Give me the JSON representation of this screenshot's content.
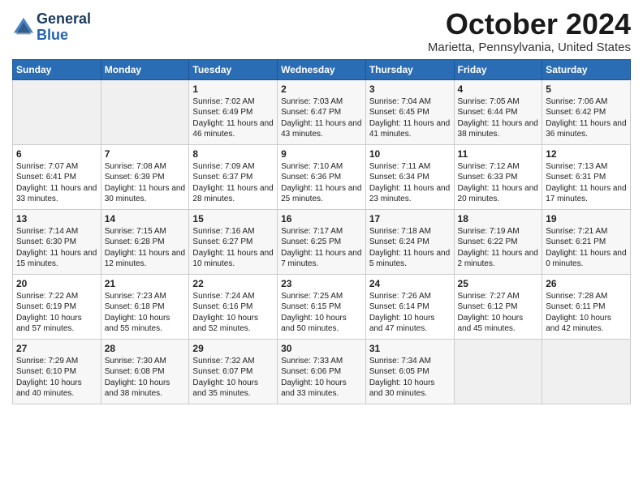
{
  "header": {
    "logo_line1": "General",
    "logo_line2": "Blue",
    "month": "October 2024",
    "location": "Marietta, Pennsylvania, United States"
  },
  "weekdays": [
    "Sunday",
    "Monday",
    "Tuesday",
    "Wednesday",
    "Thursday",
    "Friday",
    "Saturday"
  ],
  "weeks": [
    [
      {
        "day": "",
        "sunrise": "",
        "sunset": "",
        "daylight": ""
      },
      {
        "day": "",
        "sunrise": "",
        "sunset": "",
        "daylight": ""
      },
      {
        "day": "1",
        "sunrise": "Sunrise: 7:02 AM",
        "sunset": "Sunset: 6:49 PM",
        "daylight": "Daylight: 11 hours and 46 minutes."
      },
      {
        "day": "2",
        "sunrise": "Sunrise: 7:03 AM",
        "sunset": "Sunset: 6:47 PM",
        "daylight": "Daylight: 11 hours and 43 minutes."
      },
      {
        "day": "3",
        "sunrise": "Sunrise: 7:04 AM",
        "sunset": "Sunset: 6:45 PM",
        "daylight": "Daylight: 11 hours and 41 minutes."
      },
      {
        "day": "4",
        "sunrise": "Sunrise: 7:05 AM",
        "sunset": "Sunset: 6:44 PM",
        "daylight": "Daylight: 11 hours and 38 minutes."
      },
      {
        "day": "5",
        "sunrise": "Sunrise: 7:06 AM",
        "sunset": "Sunset: 6:42 PM",
        "daylight": "Daylight: 11 hours and 36 minutes."
      }
    ],
    [
      {
        "day": "6",
        "sunrise": "Sunrise: 7:07 AM",
        "sunset": "Sunset: 6:41 PM",
        "daylight": "Daylight: 11 hours and 33 minutes."
      },
      {
        "day": "7",
        "sunrise": "Sunrise: 7:08 AM",
        "sunset": "Sunset: 6:39 PM",
        "daylight": "Daylight: 11 hours and 30 minutes."
      },
      {
        "day": "8",
        "sunrise": "Sunrise: 7:09 AM",
        "sunset": "Sunset: 6:37 PM",
        "daylight": "Daylight: 11 hours and 28 minutes."
      },
      {
        "day": "9",
        "sunrise": "Sunrise: 7:10 AM",
        "sunset": "Sunset: 6:36 PM",
        "daylight": "Daylight: 11 hours and 25 minutes."
      },
      {
        "day": "10",
        "sunrise": "Sunrise: 7:11 AM",
        "sunset": "Sunset: 6:34 PM",
        "daylight": "Daylight: 11 hours and 23 minutes."
      },
      {
        "day": "11",
        "sunrise": "Sunrise: 7:12 AM",
        "sunset": "Sunset: 6:33 PM",
        "daylight": "Daylight: 11 hours and 20 minutes."
      },
      {
        "day": "12",
        "sunrise": "Sunrise: 7:13 AM",
        "sunset": "Sunset: 6:31 PM",
        "daylight": "Daylight: 11 hours and 17 minutes."
      }
    ],
    [
      {
        "day": "13",
        "sunrise": "Sunrise: 7:14 AM",
        "sunset": "Sunset: 6:30 PM",
        "daylight": "Daylight: 11 hours and 15 minutes."
      },
      {
        "day": "14",
        "sunrise": "Sunrise: 7:15 AM",
        "sunset": "Sunset: 6:28 PM",
        "daylight": "Daylight: 11 hours and 12 minutes."
      },
      {
        "day": "15",
        "sunrise": "Sunrise: 7:16 AM",
        "sunset": "Sunset: 6:27 PM",
        "daylight": "Daylight: 11 hours and 10 minutes."
      },
      {
        "day": "16",
        "sunrise": "Sunrise: 7:17 AM",
        "sunset": "Sunset: 6:25 PM",
        "daylight": "Daylight: 11 hours and 7 minutes."
      },
      {
        "day": "17",
        "sunrise": "Sunrise: 7:18 AM",
        "sunset": "Sunset: 6:24 PM",
        "daylight": "Daylight: 11 hours and 5 minutes."
      },
      {
        "day": "18",
        "sunrise": "Sunrise: 7:19 AM",
        "sunset": "Sunset: 6:22 PM",
        "daylight": "Daylight: 11 hours and 2 minutes."
      },
      {
        "day": "19",
        "sunrise": "Sunrise: 7:21 AM",
        "sunset": "Sunset: 6:21 PM",
        "daylight": "Daylight: 11 hours and 0 minutes."
      }
    ],
    [
      {
        "day": "20",
        "sunrise": "Sunrise: 7:22 AM",
        "sunset": "Sunset: 6:19 PM",
        "daylight": "Daylight: 10 hours and 57 minutes."
      },
      {
        "day": "21",
        "sunrise": "Sunrise: 7:23 AM",
        "sunset": "Sunset: 6:18 PM",
        "daylight": "Daylight: 10 hours and 55 minutes."
      },
      {
        "day": "22",
        "sunrise": "Sunrise: 7:24 AM",
        "sunset": "Sunset: 6:16 PM",
        "daylight": "Daylight: 10 hours and 52 minutes."
      },
      {
        "day": "23",
        "sunrise": "Sunrise: 7:25 AM",
        "sunset": "Sunset: 6:15 PM",
        "daylight": "Daylight: 10 hours and 50 minutes."
      },
      {
        "day": "24",
        "sunrise": "Sunrise: 7:26 AM",
        "sunset": "Sunset: 6:14 PM",
        "daylight": "Daylight: 10 hours and 47 minutes."
      },
      {
        "day": "25",
        "sunrise": "Sunrise: 7:27 AM",
        "sunset": "Sunset: 6:12 PM",
        "daylight": "Daylight: 10 hours and 45 minutes."
      },
      {
        "day": "26",
        "sunrise": "Sunrise: 7:28 AM",
        "sunset": "Sunset: 6:11 PM",
        "daylight": "Daylight: 10 hours and 42 minutes."
      }
    ],
    [
      {
        "day": "27",
        "sunrise": "Sunrise: 7:29 AM",
        "sunset": "Sunset: 6:10 PM",
        "daylight": "Daylight: 10 hours and 40 minutes."
      },
      {
        "day": "28",
        "sunrise": "Sunrise: 7:30 AM",
        "sunset": "Sunset: 6:08 PM",
        "daylight": "Daylight: 10 hours and 38 minutes."
      },
      {
        "day": "29",
        "sunrise": "Sunrise: 7:32 AM",
        "sunset": "Sunset: 6:07 PM",
        "daylight": "Daylight: 10 hours and 35 minutes."
      },
      {
        "day": "30",
        "sunrise": "Sunrise: 7:33 AM",
        "sunset": "Sunset: 6:06 PM",
        "daylight": "Daylight: 10 hours and 33 minutes."
      },
      {
        "day": "31",
        "sunrise": "Sunrise: 7:34 AM",
        "sunset": "Sunset: 6:05 PM",
        "daylight": "Daylight: 10 hours and 30 minutes."
      },
      {
        "day": "",
        "sunrise": "",
        "sunset": "",
        "daylight": ""
      },
      {
        "day": "",
        "sunrise": "",
        "sunset": "",
        "daylight": ""
      }
    ]
  ]
}
